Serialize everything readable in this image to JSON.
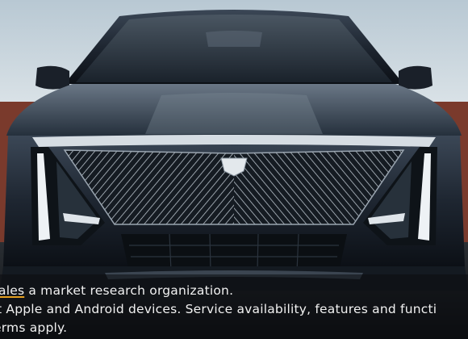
{
  "image": {
    "subject": "cadillac-lyriq-front-view"
  },
  "disclaimer": {
    "line1_link": "ales",
    "line1_rest": " a market research organization.",
    "line2": "t Apple and Android devices. Service availability, features and functi",
    "line3": "erms apply."
  },
  "colors": {
    "sky": "#c9d6df",
    "wall": "#7a3a2c",
    "car_body": "#1b2430",
    "grille_light": "#c8cfd6",
    "text": "#f1f1f1"
  }
}
